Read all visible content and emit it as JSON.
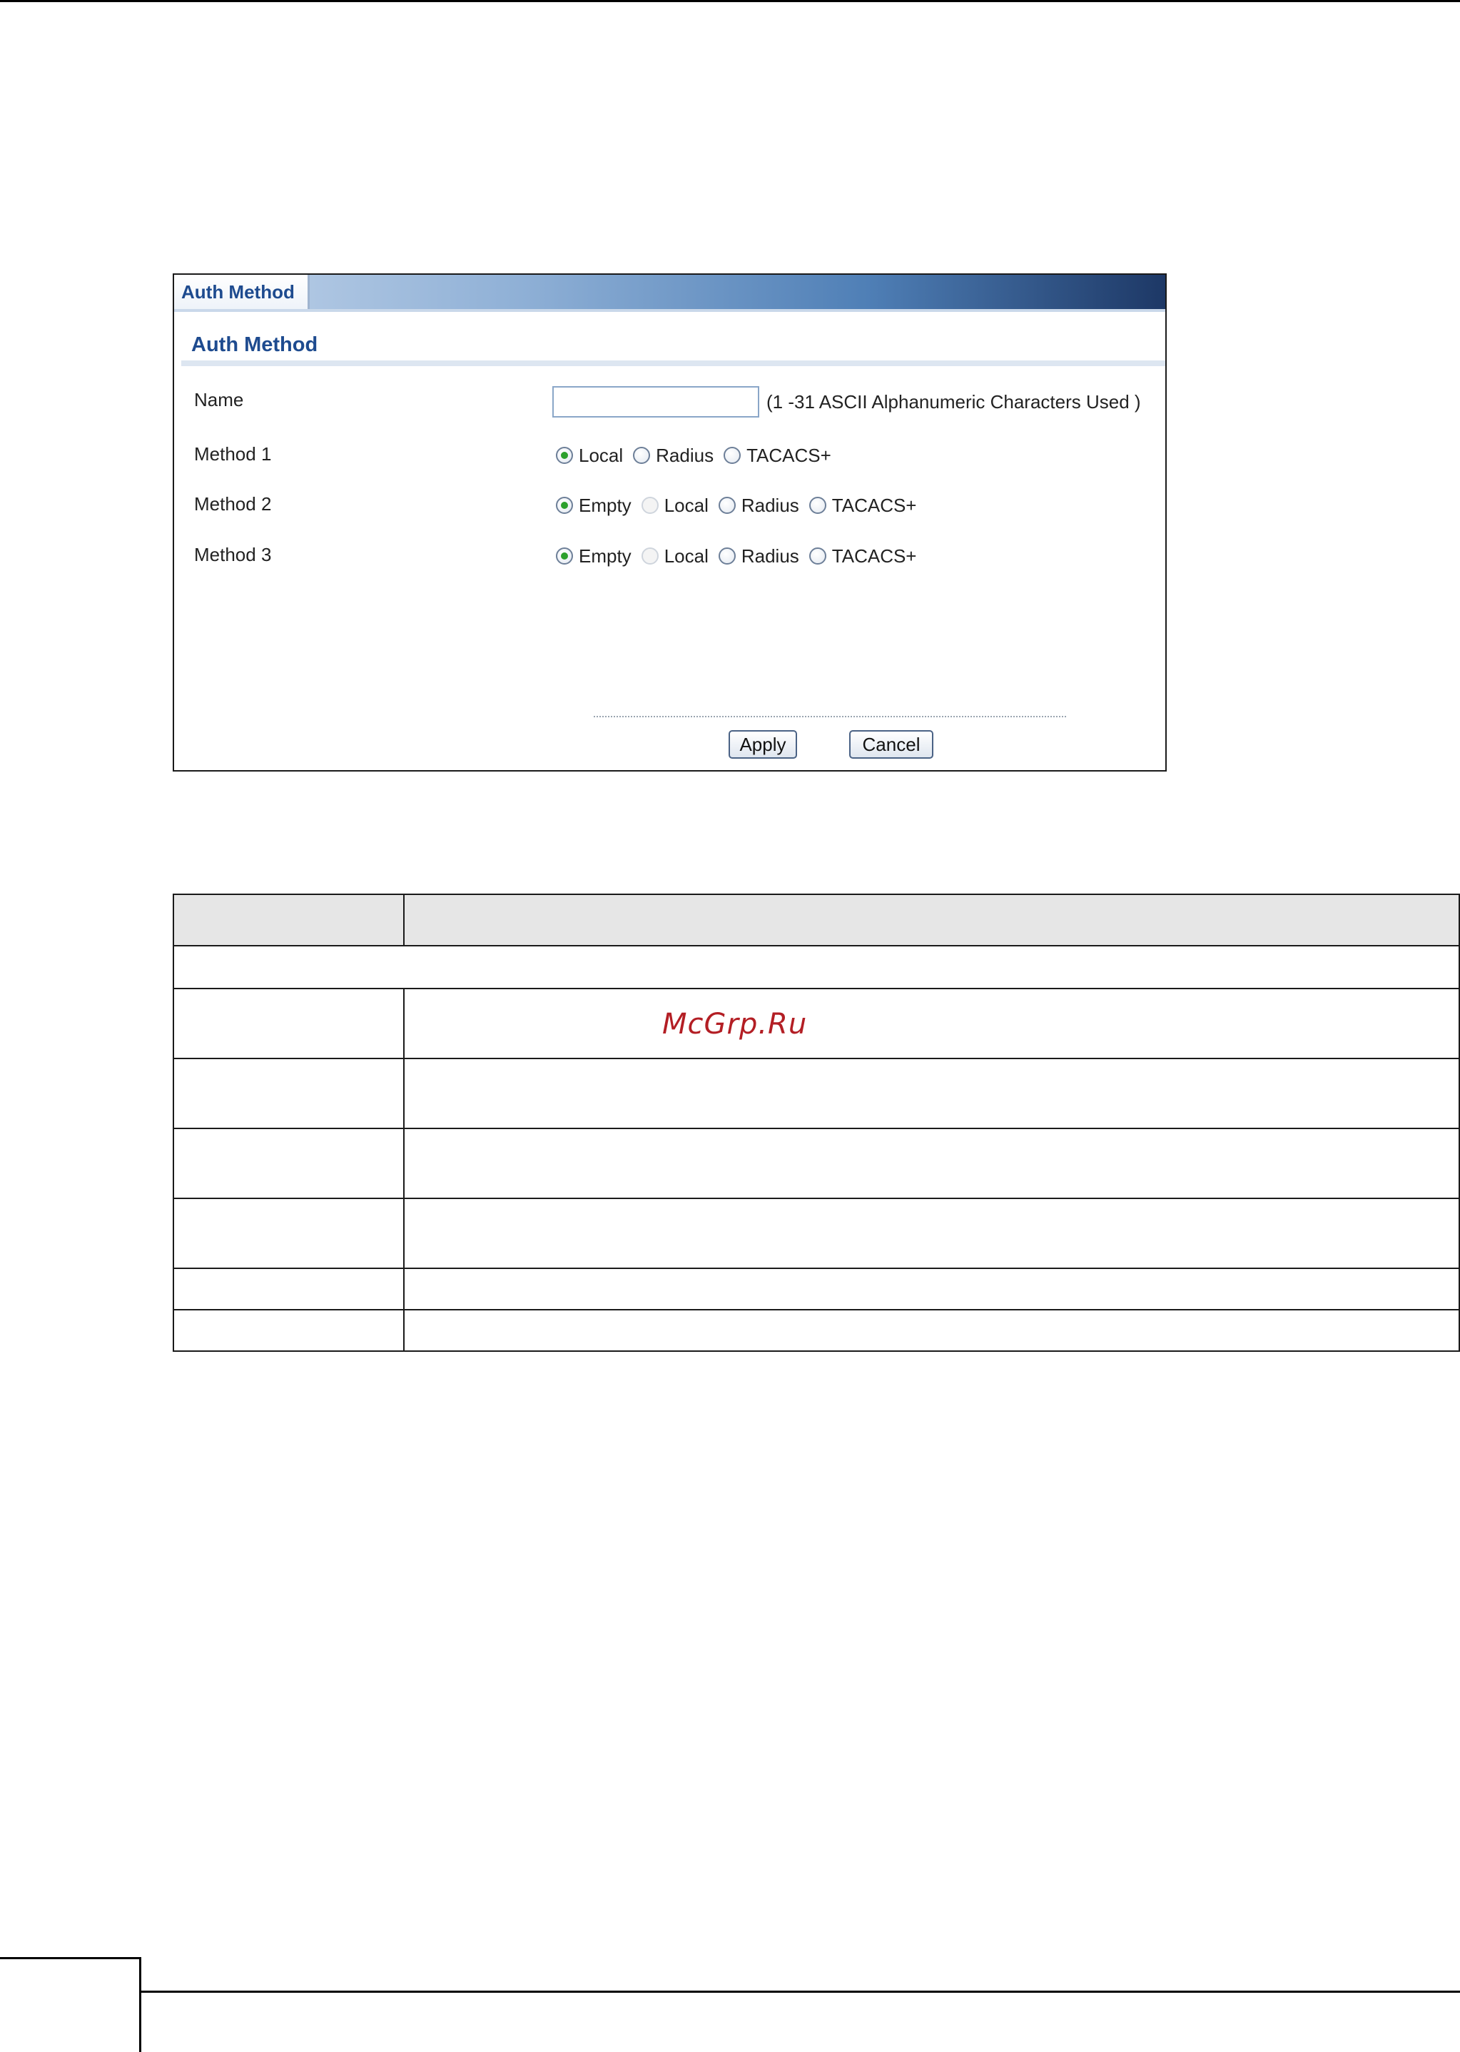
{
  "panel": {
    "tab_label": "Auth Method",
    "section_title": "Auth Method",
    "name_label": "Name",
    "name_value": "",
    "name_hint": "(1 -31 ASCII Alphanumeric Characters Used )",
    "methods": [
      {
        "label": "Method 1",
        "options": [
          {
            "text": "Local",
            "checked": true,
            "disabled": false
          },
          {
            "text": "Radius",
            "checked": false,
            "disabled": false
          },
          {
            "text": "TACACS+",
            "checked": false,
            "disabled": false
          }
        ]
      },
      {
        "label": "Method 2",
        "options": [
          {
            "text": "Empty",
            "checked": true,
            "disabled": false
          },
          {
            "text": "Local",
            "checked": false,
            "disabled": true
          },
          {
            "text": "Radius",
            "checked": false,
            "disabled": false
          },
          {
            "text": "TACACS+",
            "checked": false,
            "disabled": false
          }
        ]
      },
      {
        "label": "Method 3",
        "options": [
          {
            "text": "Empty",
            "checked": true,
            "disabled": false
          },
          {
            "text": "Local",
            "checked": false,
            "disabled": true
          },
          {
            "text": "Radius",
            "checked": false,
            "disabled": false
          },
          {
            "text": "TACACS+",
            "checked": false,
            "disabled": false
          }
        ]
      }
    ],
    "apply_label": "Apply",
    "cancel_label": "Cancel"
  },
  "watermark": "McGrp.Ru",
  "colors": {
    "accent": "#1e4b8f",
    "checked_radio": "#2ca02c",
    "watermark": "#b31e24"
  }
}
